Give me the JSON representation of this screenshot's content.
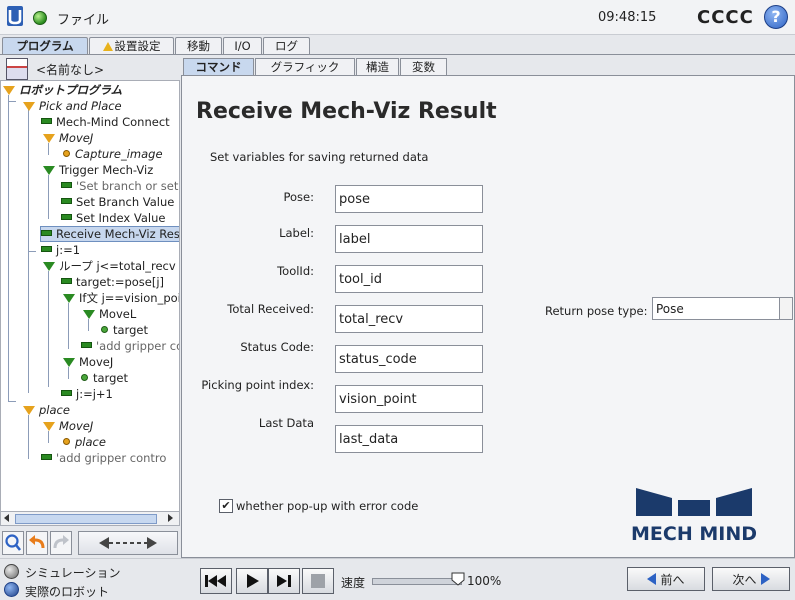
{
  "header": {
    "menu_file": "ファイル",
    "time": "09:48:15",
    "robot_name": "CCCC",
    "help_label": "?"
  },
  "main_tabs": [
    {
      "label": "プログラム",
      "active": true
    },
    {
      "label": "設置設定",
      "warning": true
    },
    {
      "label": "移動"
    },
    {
      "label": "I/O"
    },
    {
      "label": "ログ"
    }
  ],
  "program": {
    "name": "<名前なし>"
  },
  "tree": [
    {
      "label": "ロボットプログラム",
      "style": "bold",
      "icon": "tri"
    },
    {
      "label": "Pick and Place",
      "style": "italic",
      "icon": "tri"
    },
    {
      "label": "Mech-Mind Connect",
      "icon": "dash"
    },
    {
      "label": "MoveJ",
      "style": "italic",
      "icon": "tri"
    },
    {
      "label": "Capture_image",
      "style": "italic",
      "icon": "circ"
    },
    {
      "label": "Trigger Mech-Viz",
      "icon": "tri-g"
    },
    {
      "label": "'Set branch or set i",
      "style": "gray",
      "icon": "dash"
    },
    {
      "label": "Set Branch Value",
      "icon": "dash"
    },
    {
      "label": "Set Index Value",
      "icon": "dash"
    },
    {
      "label": "Receive Mech-Viz Res",
      "icon": "dash",
      "selected": true
    },
    {
      "label": "j:=1",
      "icon": "dash"
    },
    {
      "label": "ループ j<=total_recv",
      "icon": "tri-g"
    },
    {
      "label": "target:=pose[j]",
      "icon": "dash"
    },
    {
      "label": "If文 j==vision_poi",
      "icon": "tri-g"
    },
    {
      "label": "MoveL",
      "icon": "tri-g"
    },
    {
      "label": "target",
      "icon": "circ-g"
    },
    {
      "label": "'add gripper co",
      "style": "gray",
      "icon": "dash"
    },
    {
      "label": "MoveJ",
      "icon": "tri-g"
    },
    {
      "label": "target",
      "icon": "circ-g"
    },
    {
      "label": "j:=j+1",
      "icon": "dash"
    },
    {
      "label": "place",
      "style": "italic",
      "icon": "tri"
    },
    {
      "label": "MoveJ",
      "style": "italic",
      "icon": "tri"
    },
    {
      "label": "place",
      "style": "italic",
      "icon": "circ"
    },
    {
      "label": "'add gripper contro",
      "style": "gray",
      "icon": "dash"
    }
  ],
  "sub_tabs": [
    {
      "label": "コマンド",
      "active": true
    },
    {
      "label": "グラフィック"
    },
    {
      "label": "構造"
    },
    {
      "label": "変数"
    }
  ],
  "command": {
    "title": "Receive Mech-Viz Result",
    "subtitle": "Set variables for saving returned data",
    "fields": [
      {
        "label": "Pose:",
        "value": "pose"
      },
      {
        "label": "Label:",
        "value": "label"
      },
      {
        "label": "ToolId:",
        "value": "tool_id"
      },
      {
        "label": "Total Received:",
        "value": "total_recv"
      },
      {
        "label": "Status Code:",
        "value": "status_code"
      },
      {
        "label": "Picking point index:",
        "value": "vision_point"
      },
      {
        "label": "Last Data",
        "value": "last_data"
      }
    ],
    "return_pose_label": "Return pose type:",
    "return_pose_value": "Pose",
    "checkbox_label": "whether pop-up with error code",
    "checkbox_checked": true,
    "logo_text": "MECH MIND"
  },
  "bottom": {
    "mode_simulation": "シミュレーション",
    "mode_real": "実際のロボット",
    "speed_label": "速度",
    "speed_value": "100%",
    "speed_fraction": 1.0,
    "prev_label": "前へ",
    "next_label": "次へ"
  }
}
